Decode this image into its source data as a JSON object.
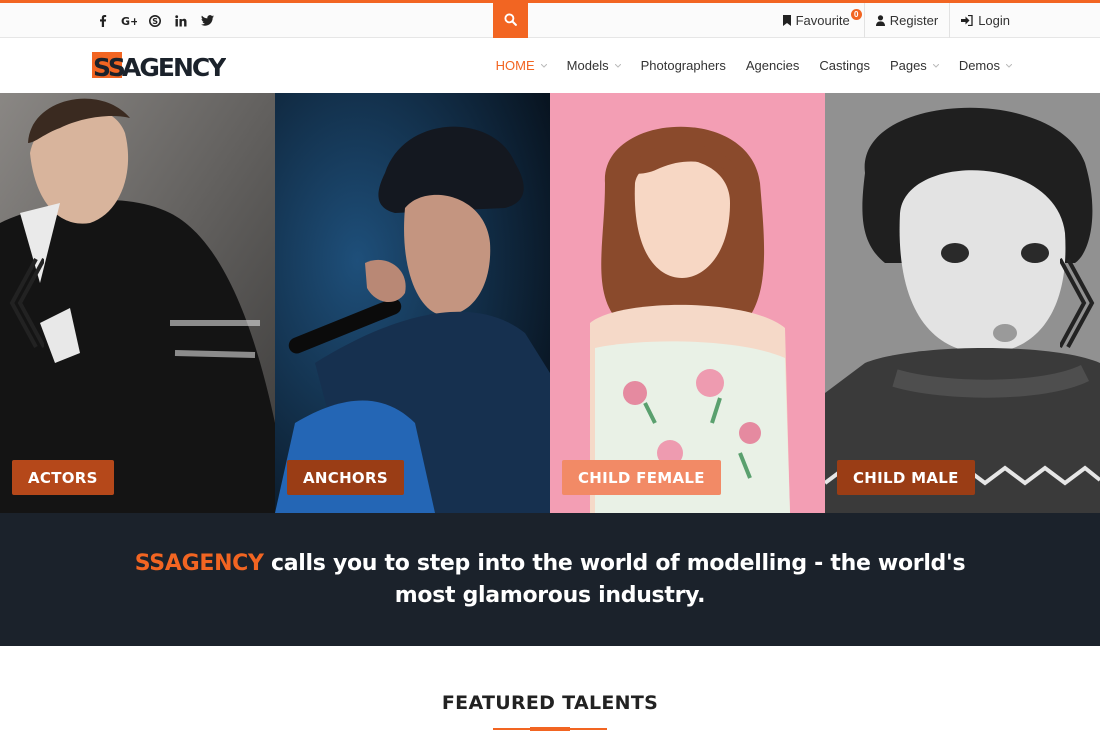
{
  "colors": {
    "accent": "#f26522",
    "dark": "#1b222b"
  },
  "social": [
    {
      "name": "facebook-icon"
    },
    {
      "name": "google-plus-icon"
    },
    {
      "name": "skype-icon"
    },
    {
      "name": "linkedin-icon"
    },
    {
      "name": "twitter-icon"
    }
  ],
  "toplinks": {
    "favourite_label": "Favourite",
    "favourite_count": "0",
    "register_label": "Register",
    "login_label": "Login"
  },
  "logo": {
    "text": "SSAGENCY"
  },
  "nav": {
    "items": [
      {
        "label": "HOME",
        "active": true,
        "dropdown": true
      },
      {
        "label": "Models",
        "dropdown": true
      },
      {
        "label": "Photographers",
        "dropdown": false
      },
      {
        "label": "Agencies",
        "dropdown": false
      },
      {
        "label": "Castings",
        "dropdown": false
      },
      {
        "label": "Pages",
        "dropdown": true
      },
      {
        "label": "Demos",
        "dropdown": true
      }
    ]
  },
  "hero": {
    "categories": [
      {
        "label": "ACTORS"
      },
      {
        "label": "ANCHORS"
      },
      {
        "label": "CHILD FEMALE"
      },
      {
        "label": "CHILD MALE"
      }
    ]
  },
  "tagline": {
    "brand": "SSAGENCY",
    "text": " calls you to step into the world of modelling - the world's most glamorous industry."
  },
  "featured": {
    "title": "FEATURED TALENTS"
  }
}
